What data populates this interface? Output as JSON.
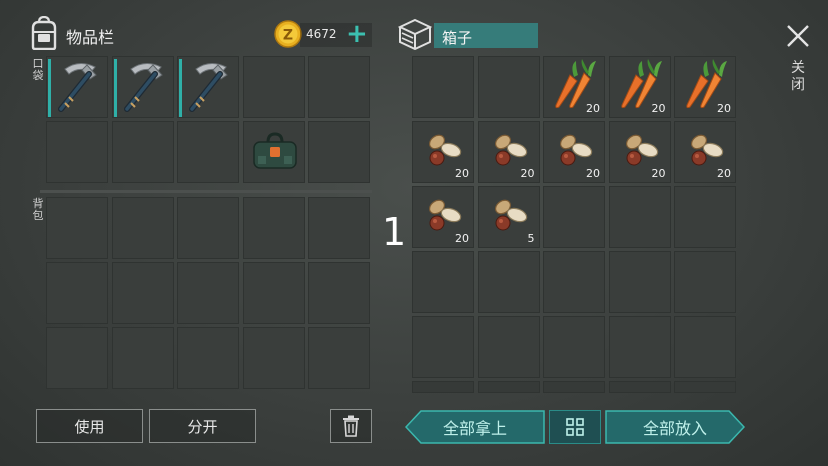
{
  "header": {
    "inventory_title": "物品栏",
    "coins": "4672",
    "plus_icon": "plus-icon",
    "container_title": "箱子",
    "close_label": "关闭"
  },
  "pocket": {
    "label": "口袋",
    "slots": [
      {
        "item": "pickaxe",
        "qty": "",
        "durability": true
      },
      {
        "item": "pickaxe",
        "qty": "",
        "durability": true
      },
      {
        "item": "pickaxe",
        "qty": "",
        "durability": true
      },
      {
        "item": "",
        "qty": ""
      },
      {
        "item": "",
        "qty": ""
      },
      {
        "item": "",
        "qty": ""
      },
      {
        "item": "",
        "qty": ""
      },
      {
        "item": "",
        "qty": ""
      },
      {
        "item": "backpack",
        "qty": ""
      },
      {
        "item": "",
        "qty": ""
      }
    ]
  },
  "backpack": {
    "label": "背包",
    "slots": [
      {
        "item": "",
        "qty": ""
      },
      {
        "item": "",
        "qty": ""
      },
      {
        "item": "",
        "qty": ""
      },
      {
        "item": "",
        "qty": ""
      },
      {
        "item": "",
        "qty": ""
      },
      {
        "item": "",
        "qty": ""
      },
      {
        "item": "",
        "qty": ""
      },
      {
        "item": "",
        "qty": ""
      },
      {
        "item": "",
        "qty": ""
      },
      {
        "item": "",
        "qty": ""
      },
      {
        "item": "",
        "qty": ""
      },
      {
        "item": "",
        "qty": ""
      },
      {
        "item": "",
        "qty": ""
      },
      {
        "item": "",
        "qty": ""
      },
      {
        "item": "",
        "qty": ""
      }
    ]
  },
  "container": {
    "page_number": "1",
    "slots": [
      {
        "item": "",
        "qty": ""
      },
      {
        "item": "",
        "qty": ""
      },
      {
        "item": "carrot",
        "qty": "20"
      },
      {
        "item": "carrot",
        "qty": "20"
      },
      {
        "item": "carrot",
        "qty": "20"
      },
      {
        "item": "seeds",
        "qty": "20"
      },
      {
        "item": "seeds",
        "qty": "20"
      },
      {
        "item": "seeds",
        "qty": "20"
      },
      {
        "item": "seeds",
        "qty": "20"
      },
      {
        "item": "seeds",
        "qty": "20"
      },
      {
        "item": "seeds",
        "qty": "20"
      },
      {
        "item": "seeds",
        "qty": "5"
      },
      {
        "item": "",
        "qty": ""
      },
      {
        "item": "",
        "qty": ""
      },
      {
        "item": "",
        "qty": ""
      },
      {
        "item": "",
        "qty": ""
      },
      {
        "item": "",
        "qty": ""
      },
      {
        "item": "",
        "qty": ""
      },
      {
        "item": "",
        "qty": ""
      },
      {
        "item": "",
        "qty": ""
      },
      {
        "item": "",
        "qty": ""
      },
      {
        "item": "",
        "qty": ""
      },
      {
        "item": "",
        "qty": ""
      },
      {
        "item": "",
        "qty": ""
      },
      {
        "item": "",
        "qty": ""
      }
    ]
  },
  "buttons": {
    "use": "使用",
    "split": "分开",
    "take_all": "全部拿上",
    "put_all": "全部放入"
  },
  "colors": {
    "accent_teal": "#2fb0a8",
    "title_bg": "#367c7a",
    "coin_gold": "#e8b020"
  }
}
